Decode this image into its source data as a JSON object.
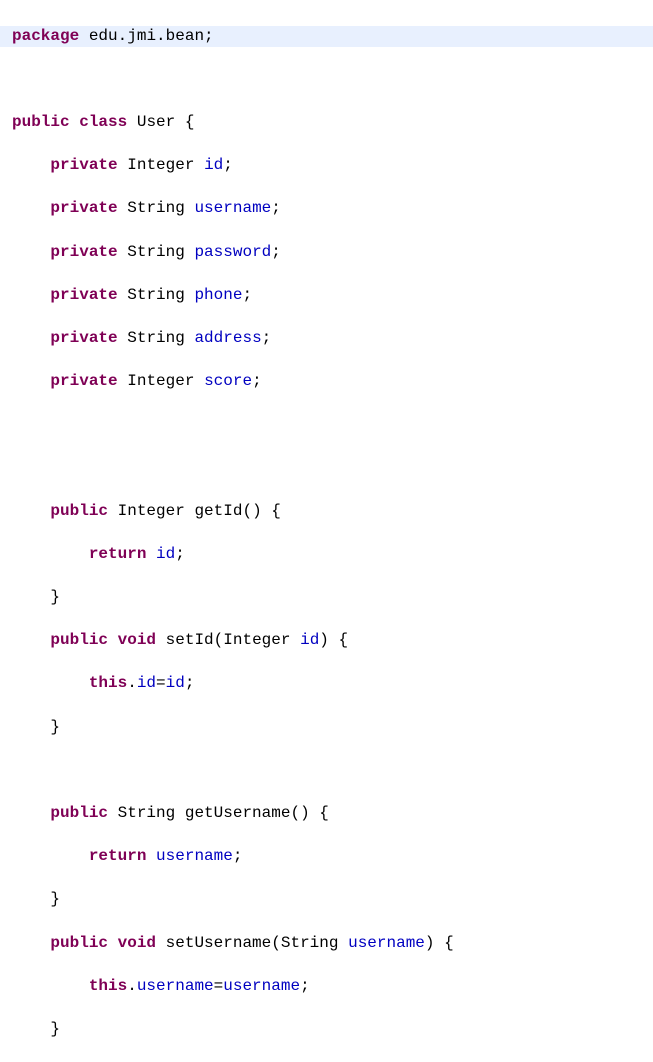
{
  "code": {
    "line1": {
      "kw_package": "package",
      "pkg": "edu.jmi.bean",
      "semi": ";"
    },
    "line3": {
      "kw_public": "public",
      "kw_class": "class",
      "cls": "User",
      "brace": "{"
    },
    "line4": {
      "kw": "private",
      "type": "Integer",
      "name": "id",
      "semi": ";"
    },
    "line5": {
      "kw": "private",
      "type": "String",
      "name": "username",
      "semi": ";"
    },
    "line6": {
      "kw": "private",
      "type": "String",
      "name": "password",
      "semi": ";"
    },
    "line7": {
      "kw": "private",
      "type": "String",
      "name": "phone",
      "semi": ";"
    },
    "line8": {
      "kw": "private",
      "type": "String",
      "name": "address",
      "semi": ";"
    },
    "line9": {
      "kw": "private",
      "type": "Integer",
      "name": "score",
      "semi": ";"
    },
    "line12": {
      "kw": "public",
      "type": "Integer",
      "method": "getId",
      "rest": "() {"
    },
    "line13": {
      "kw": "return",
      "name": "id",
      "semi": ";"
    },
    "line14": {
      "brace": "}"
    },
    "line15": {
      "kw": "public",
      "kw2": "void",
      "method": "setId",
      "paren_open": "(",
      "ptype": "Integer",
      "pname": "id",
      "rest": ") {"
    },
    "line16": {
      "kw": "this",
      "dot": ".",
      "field": "id",
      "eq": "=",
      "param": "id",
      "semi": ";"
    },
    "line17": {
      "brace": "}"
    },
    "line19": {
      "kw": "public",
      "type": "String",
      "method": "getUsername",
      "rest": "() {"
    },
    "line20": {
      "kw": "return",
      "name": "username",
      "semi": ";"
    },
    "line21": {
      "brace": "}"
    },
    "line22": {
      "kw": "public",
      "kw2": "void",
      "method": "setUsername",
      "paren_open": "(",
      "ptype": "String",
      "pname": "username",
      "rest": ") {"
    },
    "line23": {
      "kw": "this",
      "dot": ".",
      "field": "username",
      "eq": "=",
      "param": "username",
      "semi": ";"
    },
    "line24": {
      "brace": "}"
    }
  }
}
